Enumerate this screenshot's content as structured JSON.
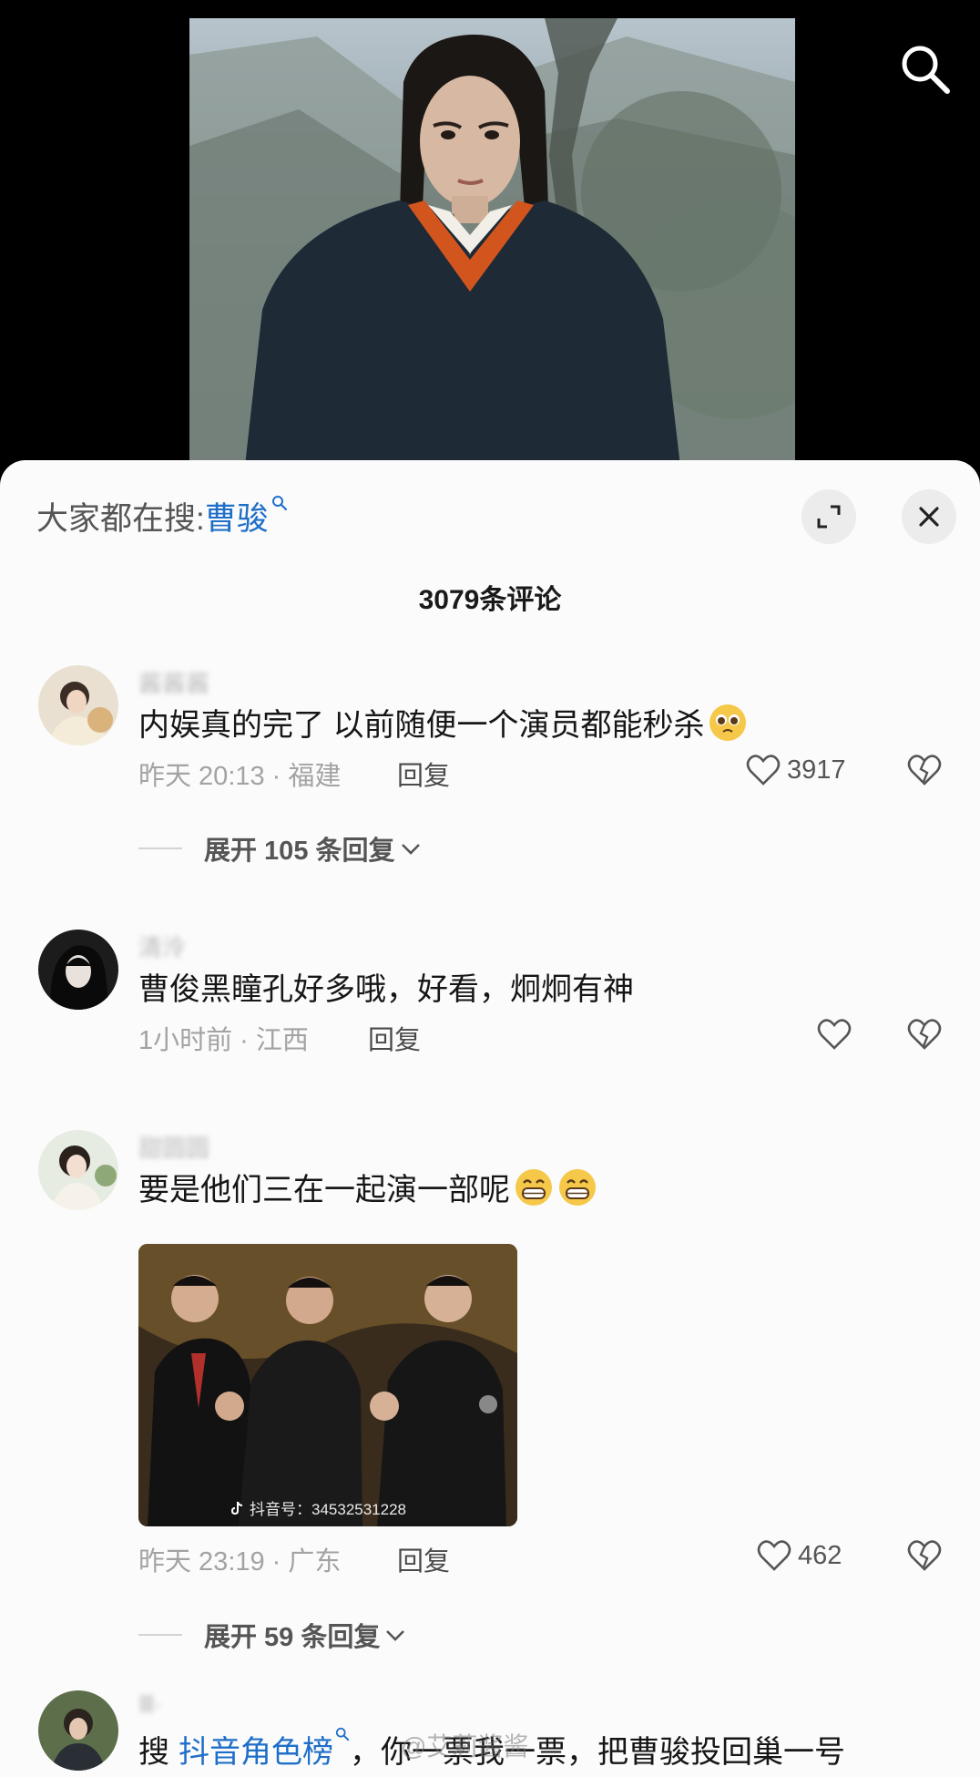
{
  "header": {
    "trending_prefix": "大家都在搜:",
    "trending_term": "曹骏",
    "comment_count": "3079条评论"
  },
  "comments": [
    {
      "username": "酱酱酱",
      "text": "内娱真的完了 以前随便一个演员都能秒杀",
      "emoji": "pleading-face",
      "time_location": "昨天 20:13 · 福建",
      "reply_label": "回复",
      "likes": "3917",
      "expand_label": "展开 105 条回复"
    },
    {
      "username": "清泠",
      "text": "曹俊黑瞳孔好多哦，好看，炯炯有神",
      "time_location": "1小时前 · 江西",
      "reply_label": "回复",
      "likes": ""
    },
    {
      "username": "甜圆圆",
      "text": "要是他们三在一起演一部呢",
      "emoji": "grinning-face",
      "time_location": "昨天 23:19 · 广东",
      "reply_label": "回复",
      "likes": "462",
      "image_watermark": "抖音号：34532531228",
      "expand_label": "展开 59 条回复"
    },
    {
      "username": "Ⅲ·",
      "text_prefix": "搜",
      "text_link": "抖音角色榜",
      "text_suffix": "，你一票我一票，把曹骏投回巢一号",
      "watermark": "@艾莉酱酱"
    }
  ],
  "colors": {
    "link": "#1f6fc9",
    "meta": "#a3a3a3",
    "text": "#161616",
    "sheet_bg": "#fbfbfb"
  },
  "icons": [
    "search-icon",
    "expand-icon",
    "close-icon",
    "heart-icon",
    "broken-heart-icon",
    "chevron-down-icon",
    "tiktok-icon"
  ]
}
